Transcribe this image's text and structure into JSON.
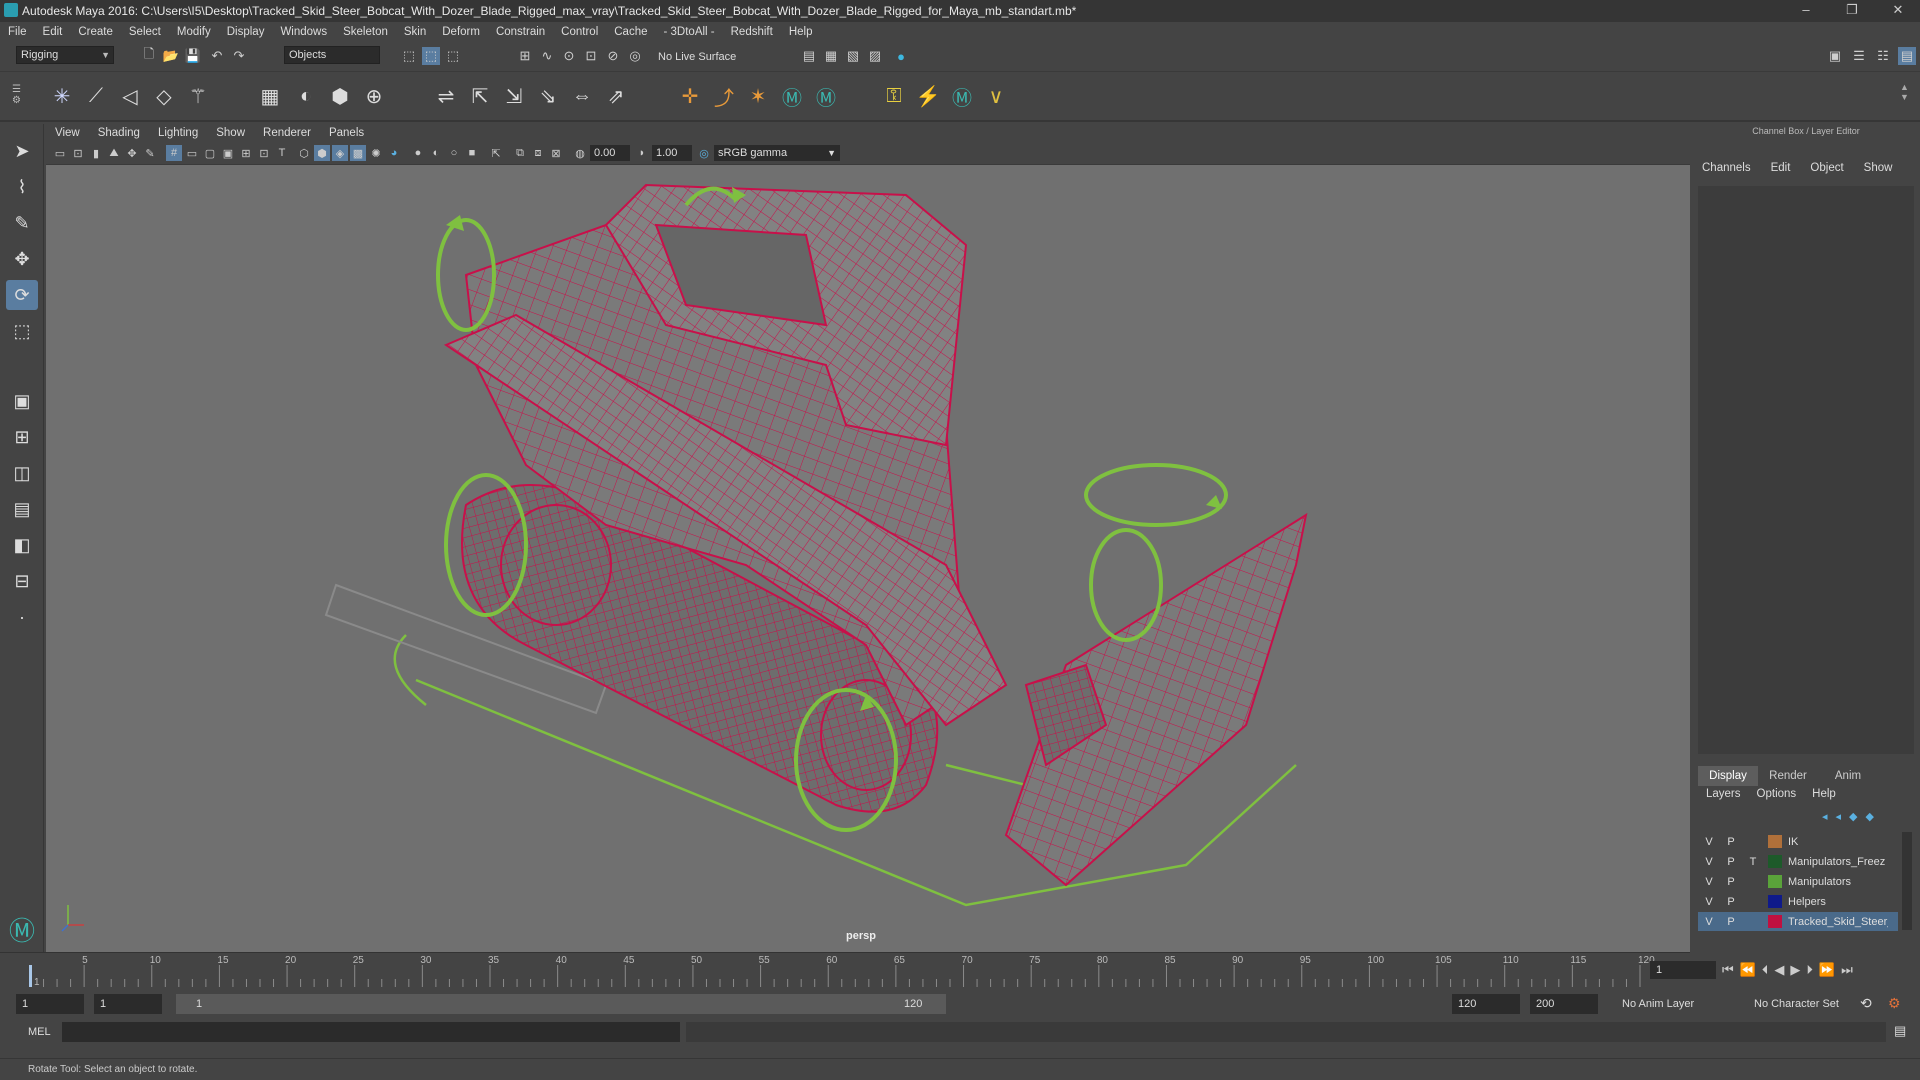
{
  "window": {
    "title": "Autodesk Maya 2016: C:\\Users\\I5\\Desktop\\Tracked_Skid_Steer_Bobcat_With_Dozer_Blade_Rigged_max_vray\\Tracked_Skid_Steer_Bobcat_With_Dozer_Blade_Rigged_for_Maya_mb_standart.mb*",
    "minimize": "–",
    "maximize": "❐",
    "close": "✕"
  },
  "menubar": [
    "File",
    "Edit",
    "Create",
    "Select",
    "Modify",
    "Display",
    "Windows",
    "Skeleton",
    "Skin",
    "Deform",
    "Constrain",
    "Control",
    "Cache",
    "- 3DtoAll -",
    "Redshift",
    "Help"
  ],
  "statusline": {
    "menuset": "Rigging",
    "selection_mode": "Objects",
    "live_surface": "No Live Surface"
  },
  "viewport": {
    "menu": [
      "View",
      "Shading",
      "Lighting",
      "Show",
      "Renderer",
      "Panels"
    ],
    "exposure": "0.00",
    "gamma": "1.00",
    "color_space": "sRGB gamma",
    "camera": "persp"
  },
  "channelbox": {
    "header": "Channel Box / Layer Editor",
    "menu": [
      "Channels",
      "Edit",
      "Object",
      "Show"
    ]
  },
  "layer_editor": {
    "tabs": [
      "Display",
      "Render",
      "Anim"
    ],
    "active_tab": "Display",
    "menu": [
      "Layers",
      "Options",
      "Help"
    ],
    "layers": [
      {
        "v": "V",
        "p": "P",
        "t": "",
        "name": "IK",
        "color": "#b0703a"
      },
      {
        "v": "V",
        "p": "P",
        "t": "T",
        "name": "Manipulators_Freez",
        "color": "#1d5a2a"
      },
      {
        "v": "V",
        "p": "P",
        "t": "",
        "name": "Manipulators",
        "color": "#5aa33a"
      },
      {
        "v": "V",
        "p": "P",
        "t": "",
        "name": "Helpers",
        "color": "#0f1a8a"
      },
      {
        "v": "V",
        "p": "P",
        "t": "",
        "name": "Tracked_Skid_Steer_Bob",
        "color": "#c01040"
      }
    ]
  },
  "timeline": {
    "ticks": [
      "1",
      "5",
      "10",
      "15",
      "20",
      "25",
      "30",
      "35",
      "40",
      "45",
      "50",
      "55",
      "60",
      "65",
      "70",
      "75",
      "80",
      "85",
      "90",
      "95",
      "100",
      "105",
      "110",
      "115",
      "120"
    ],
    "current_frame": "1"
  },
  "range": {
    "start": "1",
    "playback_start": "1",
    "slider_start": "1",
    "slider_end": "120",
    "playback_end": "120",
    "end": "200",
    "anim_layer": "No Anim Layer",
    "char_set": "No Character Set"
  },
  "cmdline": {
    "label": "MEL"
  },
  "helpline": {
    "text": "Rotate Tool: Select an object to rotate."
  },
  "colors": {
    "wire": "#c8104a",
    "manip": "#7fc040",
    "bg": "#707070"
  }
}
